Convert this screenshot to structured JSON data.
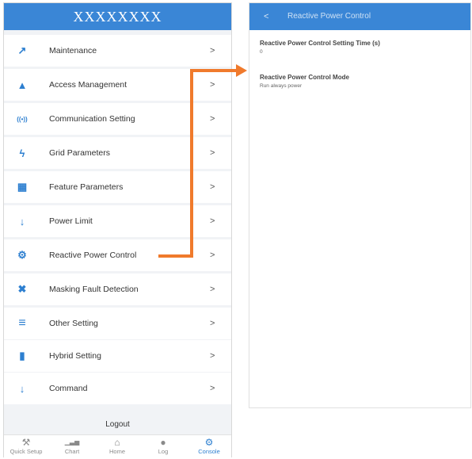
{
  "left": {
    "header_title": "XXXXXXXX",
    "menu_items": [
      {
        "label": "Maintenance",
        "icon": "wrench-icon",
        "glyph": "↗",
        "arrow": ">"
      },
      {
        "label": "Access Management",
        "icon": "user-icon",
        "glyph": "▲",
        "arrow": ">"
      },
      {
        "label": "Communication Setting",
        "icon": "signal-icon",
        "glyph": "((•))",
        "arrow": ">"
      },
      {
        "label": "Grid Parameters",
        "icon": "lightning-icon",
        "glyph": "ϟ",
        "arrow": ">"
      },
      {
        "label": "Feature Parameters",
        "icon": "grid-icon",
        "glyph": "▦",
        "arrow": ">"
      },
      {
        "label": "Power Limit",
        "icon": "down-arrow-icon",
        "glyph": "↓",
        "arrow": ">"
      },
      {
        "label": "Reactive Power Control",
        "icon": "gear-icon",
        "glyph": "⚙",
        "arrow": ">"
      },
      {
        "label": "Masking Fault Detection",
        "icon": "masking-icon",
        "glyph": "✖",
        "arrow": ">"
      },
      {
        "label": "Other Setting",
        "icon": "menu-lines-icon",
        "glyph": "≡",
        "arrow": ">"
      },
      {
        "label": "Hybrid Setting",
        "icon": "battery-icon",
        "glyph": "▮",
        "arrow": ">"
      },
      {
        "label": "Command",
        "icon": "command-icon",
        "glyph": "↓",
        "arrow": ">"
      }
    ],
    "logout_label": "Logout",
    "nav": [
      {
        "label": "Quick Setup",
        "icon": "tools-icon",
        "glyph": "⚒"
      },
      {
        "label": "Chart",
        "icon": "chart-icon",
        "glyph": "▁▃▅"
      },
      {
        "label": "Home",
        "icon": "home-icon",
        "glyph": "⌂"
      },
      {
        "label": "Log",
        "icon": "info-icon",
        "glyph": "●"
      },
      {
        "label": "Console",
        "icon": "gear-icon",
        "glyph": "⚙"
      }
    ],
    "active_nav": "Console"
  },
  "right": {
    "back_glyph": "<",
    "header_title": "Reactive Power Control",
    "settings": [
      {
        "title": "Reactive Power Control Setting Time (s)",
        "value": "0"
      },
      {
        "title": "Reactive Power Control Mode",
        "value": "Run always power"
      }
    ]
  },
  "colors": {
    "header_blue": "#3a86d6",
    "icon_blue": "#2d7fd0",
    "arrow_orange": "#f07a2c"
  }
}
